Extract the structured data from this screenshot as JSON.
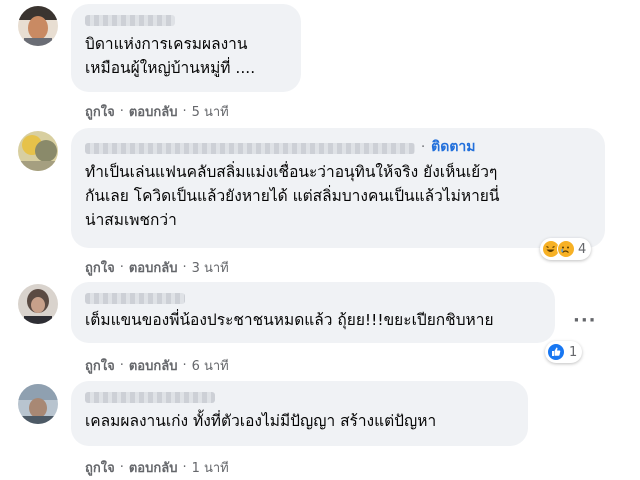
{
  "comments": [
    {
      "lines": [
        "บิดาแห่งการเครมผลงาน",
        "เหมือนผู้ใหญ่บ้านหมู่ที่ ...."
      ],
      "like": "ถูกใจ",
      "reply": "ตอบกลับ",
      "sep": "·",
      "time": "5 นาที"
    },
    {
      "follow": "ติดตาม",
      "dot": "·",
      "lines": [
        "ทำเป็นเล่นแฟนคลับสลิ่มแม่งเชื่อนะว่าอนุทินให้จริง ยังเห็นเย้วๆ",
        "กันเลย โควิดเป็นแล้วยังหายได้ แต่สลิ่มบางคนเป็นแล้วไม่หายนี่",
        "น่าสมเพชกว่า"
      ],
      "like": "ถูกใจ",
      "reply": "ตอบกลับ",
      "sep": "·",
      "time": "3 นาที",
      "reaction_count": "4",
      "reaction_icons": [
        "haha-icon",
        "sad-icon"
      ]
    },
    {
      "lines": [
        "เต็มแขนของพี่น้องประชาชนหมดแล้ว ถุ้ยย!!!ขยะเปียกชิบหาย"
      ],
      "like": "ถูกใจ",
      "reply": "ตอบกลับ",
      "sep": "·",
      "time": "6 นาที",
      "reaction_count": "1",
      "reaction_icons": [
        "like-icon"
      ]
    },
    {
      "lines": [
        "เคลมผลงานเก่ง ทั้งที่ตัวเองไม่มีปัญญา สร้างแต่ปัญหา"
      ],
      "like": "ถูกใจ",
      "reply": "ตอบกลับ",
      "sep": "·",
      "time": "1 นาที"
    }
  ],
  "menu_dots": "···",
  "colors": {
    "bubble": "#f0f2f5",
    "follow": "#216fdb",
    "meta": "#65676b",
    "like_blue": "#1877f2",
    "haha_yellow": "#f7b125"
  }
}
